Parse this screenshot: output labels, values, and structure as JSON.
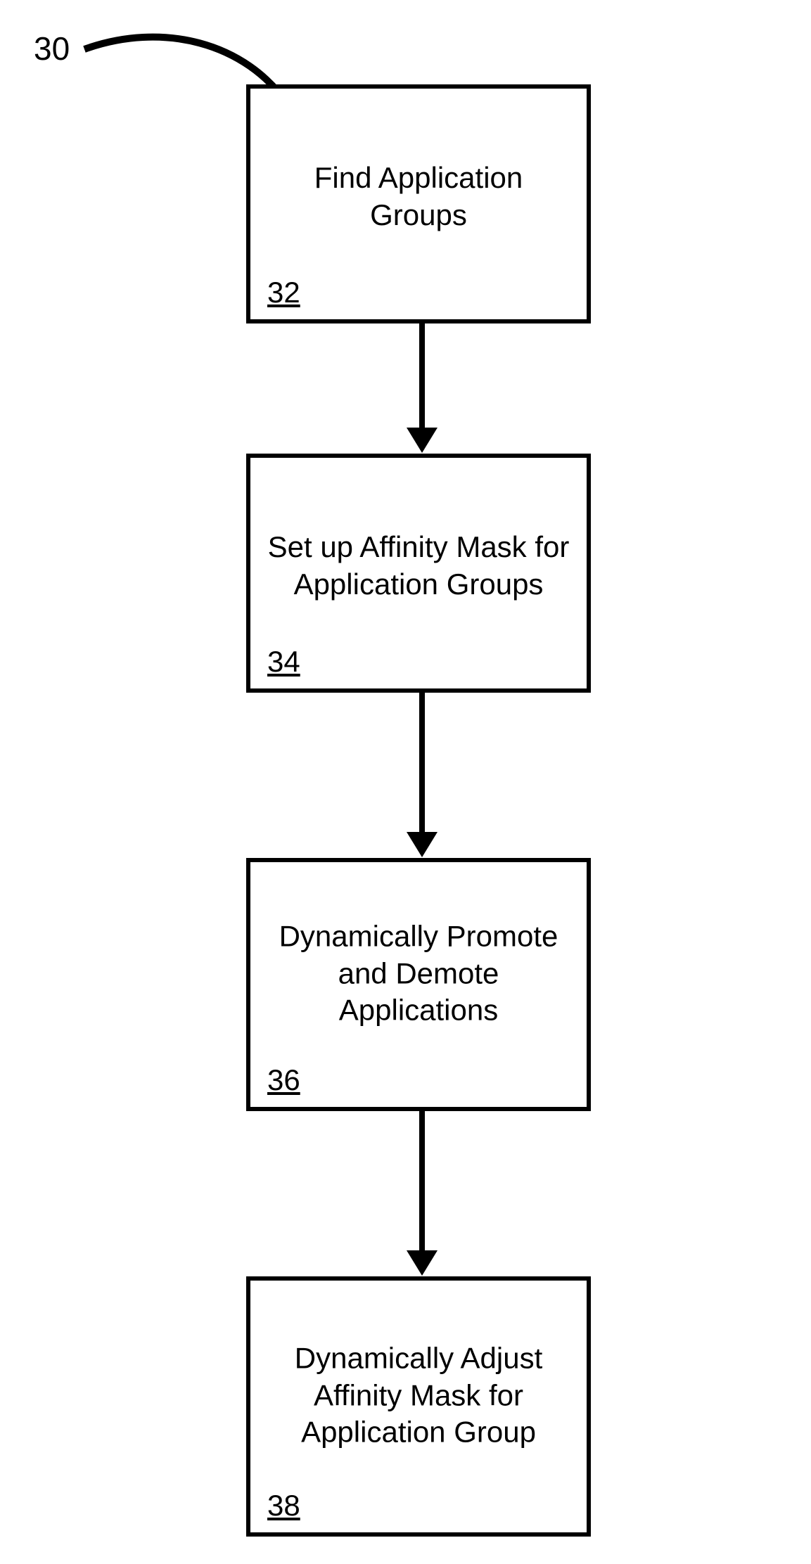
{
  "figure_label": "30",
  "boxes": [
    {
      "id": "32",
      "text": "Find Application Groups"
    },
    {
      "id": "34",
      "text": "Set up Affinity Mask for Application Groups"
    },
    {
      "id": "36",
      "text": "Dynamically Promote and Demote Applications"
    },
    {
      "id": "38",
      "text": "Dynamically Adjust Affinity Mask for Application Group"
    }
  ]
}
